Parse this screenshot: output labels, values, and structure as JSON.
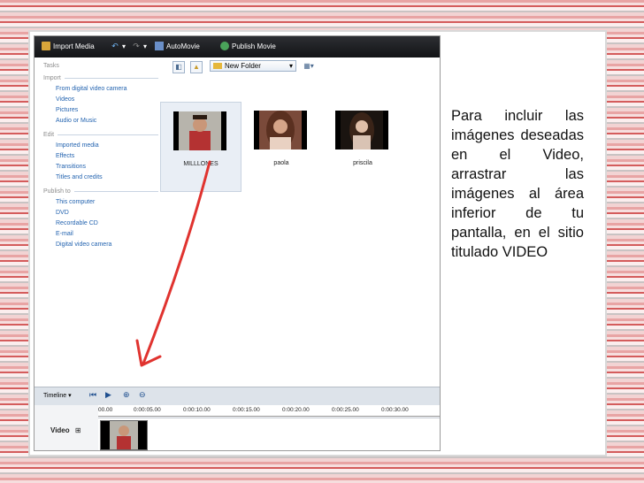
{
  "toolbar": {
    "import_media": "Import Media",
    "automovie": "AutoMovie",
    "publish_movie": "Publish Movie"
  },
  "sidebar": {
    "tasks": "Tasks",
    "import_title": "Import",
    "import_items": [
      "From digital video camera",
      "Videos",
      "Pictures",
      "Audio or Music"
    ],
    "edit_title": "Edit",
    "edit_items": [
      "Imported media",
      "Effects",
      "Transitions",
      "Titles and credits"
    ],
    "publish_title": "Publish to",
    "publish_items": [
      "This computer",
      "DVD",
      "Recordable CD",
      "E-mail",
      "Digital video camera"
    ]
  },
  "content": {
    "folder": "New Folder",
    "thumbnails": [
      {
        "label": "MILLLONES",
        "selected": true
      },
      {
        "label": "paola",
        "selected": false
      },
      {
        "label": "priscila",
        "selected": false
      }
    ]
  },
  "timeline": {
    "label": "Timeline",
    "ticks": [
      "00.00",
      "0:00:05.00",
      "0:00:10.00",
      "0:00:15.00",
      "0:00:20.00",
      "0:00:25.00",
      "0:00:30.00"
    ],
    "video_track": "Video"
  },
  "slide_text": "Para incluir las imágenes deseadas en el Video, arrastrar las imágenes al área inferior de tu pantalla, en el sitio titulado VIDEO",
  "colors": {
    "link": "#2464b0",
    "arrow": "#e0332f",
    "toolbar": "#1b1c1f"
  }
}
